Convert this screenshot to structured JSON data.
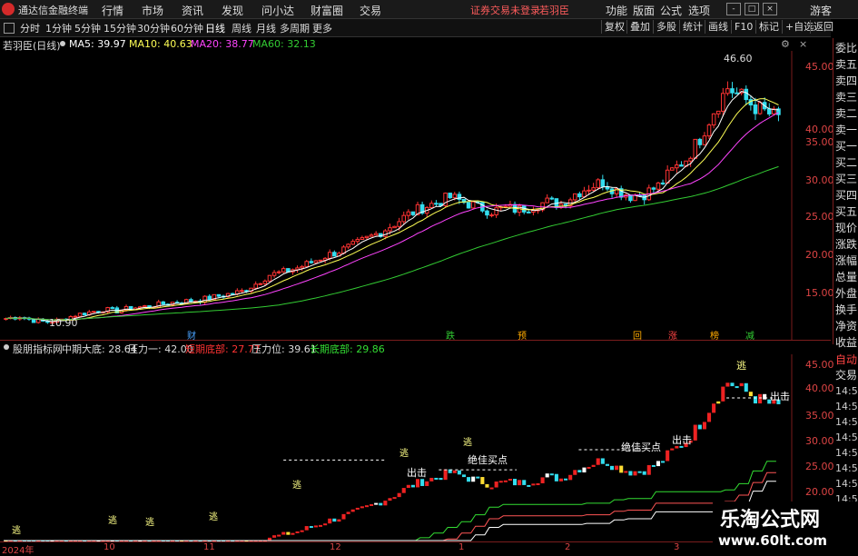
{
  "app": {
    "title": "通达信金融终端"
  },
  "menu": [
    "行情",
    "市场",
    "资讯",
    "发现",
    "问小达",
    "财富圈",
    "交易"
  ],
  "warning": "证券交易未登录",
  "stock_name_top": "若羽臣",
  "right_menu": [
    "功能",
    "版面",
    "公式",
    "选项"
  ],
  "user_button": "游客",
  "window_buttons": [
    "-",
    "□",
    "×"
  ],
  "periods": [
    "分时",
    "1分钟",
    "5分钟",
    "15分钟",
    "30分钟",
    "60分钟",
    "日线",
    "周线",
    "月线",
    "多周期",
    "更多"
  ],
  "active_period": "日线",
  "toolbar": [
    "复权",
    "叠加",
    "多股",
    "统计",
    "画线",
    "F10",
    "标记",
    "+自选",
    "返回"
  ],
  "main_chart": {
    "title": "若羽臣(日线)",
    "ma": [
      {
        "label": "MA5: 39.97",
        "color": "#ffffff"
      },
      {
        "label": "MA10: 40.63",
        "color": "#ffff55"
      },
      {
        "label": "MA20: 38.77",
        "color": "#ff44ff"
      },
      {
        "label": "MA60: 32.13",
        "color": "#33cc33"
      }
    ],
    "y_ticks": [
      "45.00",
      "40.00",
      "35.00",
      "30.00",
      "25.00",
      "20.00",
      "15.00"
    ],
    "high_label": "46.60",
    "low_label": "10.90",
    "events": [
      {
        "label": "财",
        "color": "#4aa3ff"
      },
      {
        "label": "跌",
        "color": "#33cc33"
      },
      {
        "label": "预",
        "color": "#ffaa00"
      },
      {
        "label": "回",
        "color": "#ffaa00"
      },
      {
        "label": "涨",
        "color": "#ff4444"
      },
      {
        "label": "榜",
        "color": "#ffaa00"
      },
      {
        "label": "减",
        "color": "#33cc33"
      }
    ]
  },
  "side_panel": [
    "委比",
    "卖五",
    "卖四",
    "卖三",
    "卖二",
    "卖一",
    "买一",
    "买二",
    "买三",
    "买四",
    "买五",
    "现价",
    "涨跌",
    "涨幅",
    "总量",
    "外盘",
    "换手",
    "净资",
    "收益"
  ],
  "indicator": {
    "title": "股朋指标网",
    "items": [
      {
        "label": "中期大底: 28.64",
        "color": "#dddddd"
      },
      {
        "label": "压力一: 42.00",
        "color": "#dddddd"
      },
      {
        "label": "短期底部: 27.77",
        "color": "#ff3333"
      },
      {
        "label": "压力位: 39.61",
        "color": "#dddddd"
      },
      {
        "label": "长期底部: 29.86",
        "color": "#33dd33"
      }
    ],
    "y_ticks": [
      "45.00",
      "40.00",
      "35.00",
      "30.00",
      "25.00",
      "20.00"
    ],
    "signals": {
      "escape": "逃",
      "exit": "出击",
      "best": "绝佳买点"
    }
  },
  "side_bottom": [
    "自动",
    "交易"
  ],
  "times": [
    "14:56",
    "14:56",
    "14:56",
    "14:56",
    "14:56",
    "14:56",
    "14:56",
    "14:56",
    "14:56"
  ],
  "x_axis": [
    "2024年",
    "10",
    "11",
    "12",
    "1",
    "2",
    "3"
  ],
  "watermark": {
    "line1": "乐淘公式网",
    "line2": "www.60lt.com"
  },
  "chart_data": {
    "type": "candlestick",
    "title": "若羽臣(日线)",
    "ylim": [
      10,
      48
    ],
    "series": [
      {
        "name": "MA5",
        "values": [
          39.97
        ]
      },
      {
        "name": "MA10",
        "values": [
          40.63
        ]
      },
      {
        "name": "MA20",
        "values": [
          38.77
        ]
      },
      {
        "name": "MA60",
        "values": [
          32.13
        ]
      }
    ],
    "close_trend": [
      11.5,
      11.8,
      11.2,
      11.0,
      11.3,
      12.0,
      12.4,
      12.8,
      12.6,
      13.0,
      13.2,
      13.5,
      13.8,
      14.0,
      14.2,
      14.6,
      15.0,
      15.4,
      16.5,
      17.8,
      18.2,
      18.8,
      19.6,
      20.5,
      21.2,
      22.0,
      23.0,
      24.0,
      25.2,
      26.5,
      27.5,
      28.2,
      29.0,
      28.3,
      27.6,
      27.0,
      27.4,
      27.2,
      27.8,
      28.3,
      28.0,
      29.5,
      30.5,
      31.2,
      30.0,
      29.2,
      29.5,
      30.6,
      32.8,
      34.5,
      37.5,
      41.5,
      44.8,
      43.5,
      42.0,
      41.0,
      40.2
    ]
  }
}
